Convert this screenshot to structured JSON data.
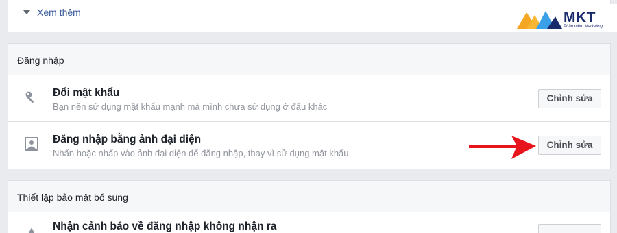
{
  "top": {
    "see_more_label": "Xem thêm"
  },
  "logo": {
    "brand": "MKT",
    "tagline": "Phần mềm Marketing",
    "colors": [
      "#1a2b6b",
      "#f5a623",
      "#3aa0e8"
    ]
  },
  "login_section": {
    "header": "Đăng nhập",
    "rows": [
      {
        "icon": "key-icon",
        "title": "Đổi mật khẩu",
        "description": "Bạn nên sử dụng mật khẩu mạnh mà mình chưa sử dụng ở đâu khác",
        "button": "Chỉnh sửa"
      },
      {
        "icon": "profile-picture-icon",
        "title": "Đăng nhập bằng ảnh đại diện",
        "description": "Nhấn hoặc nhấp vào ảnh đại diện để đăng nhập, thay vì sử dụng mật khẩu",
        "button": "Chỉnh sửa"
      }
    ]
  },
  "extra_section": {
    "header": "Thiết lập bảo mật bổ sung",
    "rows": [
      {
        "icon": "alert-icon",
        "title": "Nhận cảnh báo về đăng nhập không nhận ra"
      }
    ]
  },
  "annotation": {
    "color": "#e8141b",
    "target": "login_section.rows.1.button"
  }
}
